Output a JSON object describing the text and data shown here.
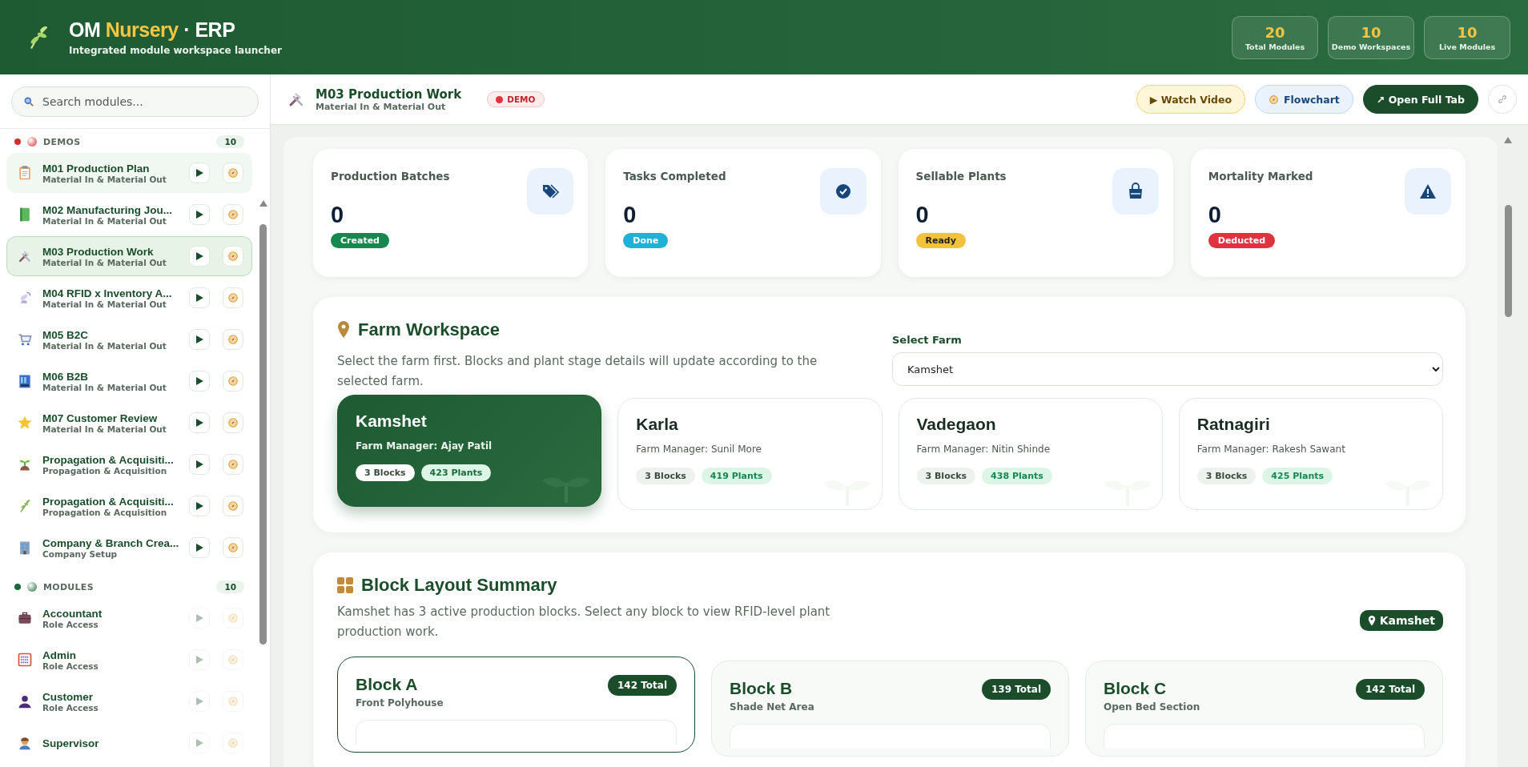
{
  "header": {
    "title_parts": [
      {
        "text": "OM ",
        "accent": false
      },
      {
        "text": "Nursery",
        "accent": true
      },
      {
        "text": " · ERP",
        "accent": false
      }
    ],
    "subtitle": "Integrated module workspace launcher",
    "stats": [
      {
        "value": "20",
        "label": "Total Modules"
      },
      {
        "value": "10",
        "label": "Demo Workspaces"
      },
      {
        "value": "10",
        "label": "Live Modules"
      }
    ]
  },
  "sidebar": {
    "search": {
      "placeholder": "Search modules..."
    },
    "groups": [
      {
        "label": "DEMOS",
        "count": "10",
        "color": "#d32f2f",
        "items": [
          {
            "kind": "clipboard",
            "title": "M01 Production Plan",
            "subtitle": "Material In & Material Out",
            "selected": false,
            "hovered": true,
            "disabled": false
          },
          {
            "kind": "book",
            "title": "M02 Manufacturing Jou...",
            "subtitle": "Material In & Material Out",
            "selected": false,
            "hovered": false,
            "disabled": false
          },
          {
            "kind": "tools",
            "title": "M03 Production Work",
            "subtitle": "Material In & Material Out",
            "selected": true,
            "hovered": false,
            "disabled": false
          },
          {
            "kind": "satellite",
            "title": "M04 RFID x Inventory A...",
            "subtitle": "Material In & Material Out",
            "selected": false,
            "hovered": false,
            "disabled": false
          },
          {
            "kind": "cart",
            "title": "M05 B2C",
            "subtitle": "Material In & Material Out",
            "selected": false,
            "hovered": false,
            "disabled": false
          },
          {
            "kind": "shop",
            "title": "M06 B2B",
            "subtitle": "Material In & Material Out",
            "selected": false,
            "hovered": false,
            "disabled": false
          },
          {
            "kind": "star",
            "title": "M07 Customer Review",
            "subtitle": "Material In & Material Out",
            "selected": false,
            "hovered": false,
            "disabled": false
          },
          {
            "kind": "sprout",
            "title": "Propagation & Acquisiti...",
            "subtitle": "Propagation & Acquisition",
            "selected": false,
            "hovered": false,
            "disabled": false
          },
          {
            "kind": "herb",
            "title": "Propagation & Acquisiti...",
            "subtitle": "Propagation & Acquisition",
            "selected": false,
            "hovered": false,
            "disabled": false
          },
          {
            "kind": "office",
            "title": "Company & Branch Crea...",
            "subtitle": "Company Setup",
            "selected": false,
            "hovered": false,
            "disabled": false
          }
        ]
      },
      {
        "label": "MODULES",
        "count": "10",
        "color": "#1b6b3a",
        "items": [
          {
            "kind": "briefcase",
            "title": "Accountant",
            "subtitle": "Role Access",
            "selected": false,
            "hovered": false,
            "disabled": true
          },
          {
            "kind": "abacus",
            "title": "Admin",
            "subtitle": "Role Access",
            "selected": false,
            "hovered": false,
            "disabled": true
          },
          {
            "kind": "person",
            "title": "Customer",
            "subtitle": "Role Access",
            "selected": false,
            "hovered": false,
            "disabled": true
          },
          {
            "kind": "worker",
            "title": "Supervisor",
            "selected": false,
            "hovered": false,
            "disabled": true
          }
        ]
      }
    ]
  },
  "topbar": {
    "kind": "tools",
    "title": "M03 Production Work",
    "subtitle": "Material In & Material Out",
    "badge": "DEMO",
    "buttons": [
      {
        "kind": "video",
        "label": "▶ Watch Video"
      },
      {
        "kind": "flowchart",
        "label": "Flowchart"
      },
      {
        "kind": "open",
        "label": "↗ Open Full Tab"
      },
      {
        "kind": "link"
      }
    ]
  },
  "stat_cards": [
    {
      "label": "Production Batches",
      "value": "0",
      "badge": "Created",
      "color": "#15884f",
      "kind": "tags"
    },
    {
      "label": "Tasks Completed",
      "value": "0",
      "badge": "Done",
      "color": "#1fb2d6",
      "kind": "check"
    },
    {
      "label": "Sellable Plants",
      "value": "0",
      "badge": "Ready",
      "color": "#f2c23a",
      "kind": "bag"
    },
    {
      "label": "Mortality Marked",
      "value": "0",
      "badge": "Deducted",
      "color": "#e0323f",
      "kind": "warning"
    }
  ],
  "farm_workspace": {
    "title": "Farm Workspace",
    "description": "Select the farm first. Blocks and plant stage details will update according to the selected farm.",
    "select_label": "Select Farm",
    "select_value": "Kamshet",
    "farms": [
      {
        "name": "Kamshet",
        "manager": "Farm Manager: Ajay Patil",
        "blocks": "3 Blocks",
        "plants": "423 Plants",
        "selected": true
      },
      {
        "name": "Karla",
        "manager": "Farm Manager: Sunil More",
        "blocks": "3 Blocks",
        "plants": "419 Plants",
        "selected": false
      },
      {
        "name": "Vadegaon",
        "manager": "Farm Manager: Nitin Shinde",
        "blocks": "3 Blocks",
        "plants": "438 Plants",
        "selected": false
      },
      {
        "name": "Ratnagiri",
        "manager": "Farm Manager: Rakesh Sawant",
        "blocks": "3 Blocks",
        "plants": "425 Plants",
        "selected": false
      }
    ]
  },
  "block_summary": {
    "title": "Block Layout Summary",
    "description": "Kamshet has 3 active production blocks. Select any block to view RFID-level plant production work.",
    "location": "Kamshet",
    "blocks": [
      {
        "name": "Block A",
        "area": "Front Polyhouse",
        "total": "142 Total",
        "selected": true
      },
      {
        "name": "Block B",
        "area": "Shade Net Area",
        "total": "139 Total",
        "selected": false
      },
      {
        "name": "Block C",
        "area": "Open Bed Section",
        "total": "142 Total",
        "selected": false
      }
    ]
  }
}
